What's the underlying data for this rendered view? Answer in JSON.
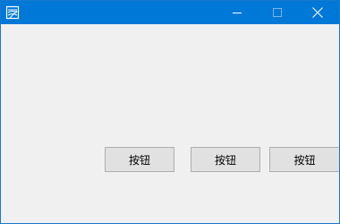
{
  "window": {
    "title": "",
    "controls": {
      "minimize_icon": "minimize-icon",
      "maximize_icon": "maximize-icon",
      "close_icon": "close-icon"
    },
    "colors": {
      "titlebar": "#0078d7",
      "client": "#f0f0f0",
      "button_face": "#e1e1e1",
      "button_border": "#adadad"
    }
  },
  "buttons": [
    {
      "label": "按钮"
    },
    {
      "label": "按钮"
    },
    {
      "label": "按钮"
    }
  ]
}
